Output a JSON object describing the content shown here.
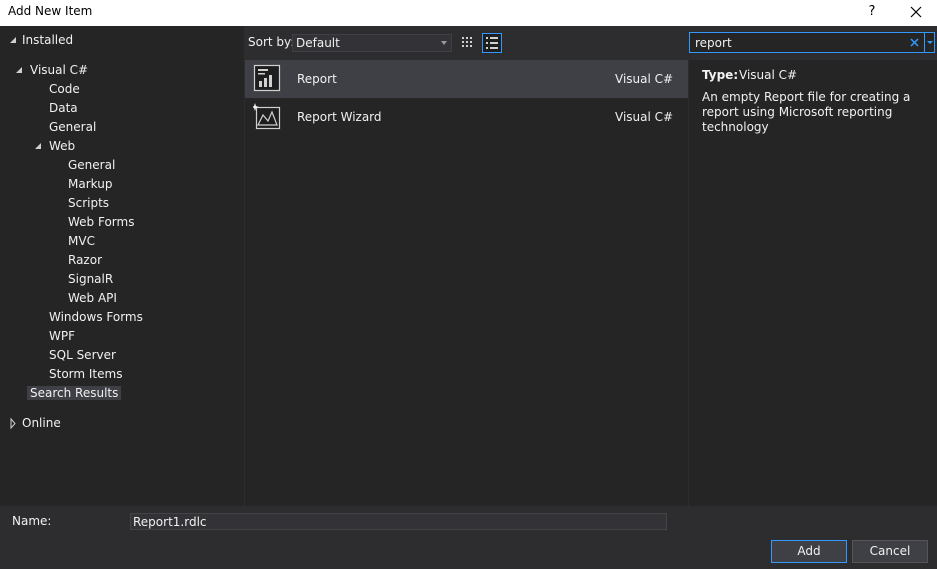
{
  "window": {
    "title": "Add New Item",
    "help_label": "?"
  },
  "tree": {
    "installed": "Installed",
    "visual_csharp": "Visual C#",
    "code": "Code",
    "data": "Data",
    "general": "General",
    "web": "Web",
    "web_general": "General",
    "markup": "Markup",
    "scripts": "Scripts",
    "web_forms": "Web Forms",
    "mvc": "MVC",
    "razor": "Razor",
    "signalr": "SignalR",
    "web_api": "Web API",
    "windows_forms": "Windows Forms",
    "wpf": "WPF",
    "sql_server": "SQL Server",
    "storm_items": "Storm Items",
    "search_results": "Search Results",
    "online": "Online"
  },
  "toolbar": {
    "sort_label": "Sort by:",
    "sort_value": "Default"
  },
  "search": {
    "value": "report"
  },
  "items": [
    {
      "name": "Report",
      "language": "Visual C#",
      "icon": "report-icon"
    },
    {
      "name": "Report Wizard",
      "language": "Visual C#",
      "icon": "report-wizard-icon"
    }
  ],
  "details": {
    "type_label": "Type:",
    "type_value": "Visual C#",
    "description": "An empty Report file for creating a report using Microsoft reporting technology"
  },
  "footer": {
    "name_label": "Name:",
    "name_value": "Report1.rdlc",
    "add_label": "Add",
    "cancel_label": "Cancel"
  },
  "colors": {
    "accent": "#3399ff",
    "background": "#2d2d30",
    "panel": "#252526",
    "selection": "#3f3f46"
  }
}
